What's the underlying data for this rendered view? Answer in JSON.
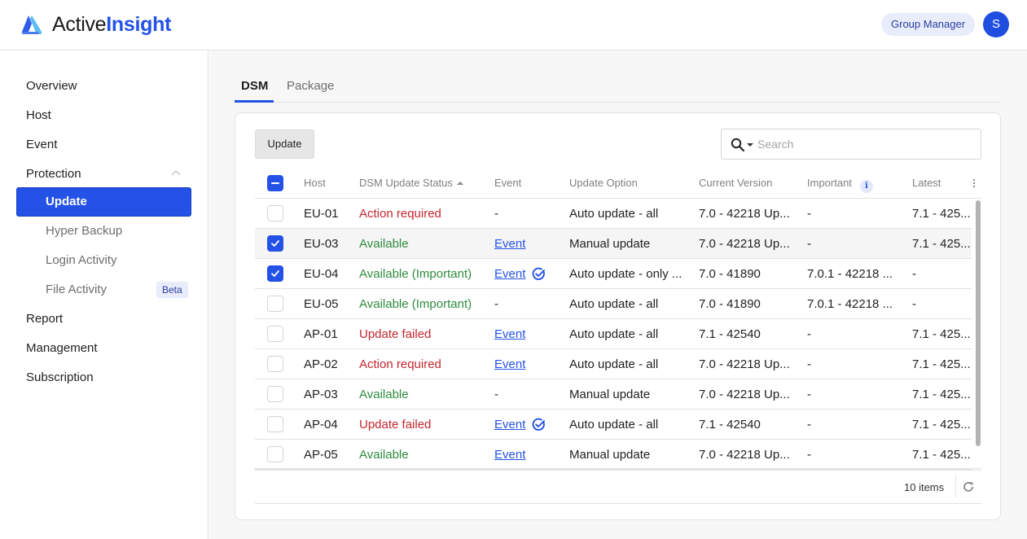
{
  "header": {
    "brand_part1": "Active",
    "brand_part2": "Insight",
    "role": "Group Manager",
    "avatar_initial": "S"
  },
  "sidebar": {
    "items": [
      {
        "label": "Overview"
      },
      {
        "label": "Host"
      },
      {
        "label": "Event"
      },
      {
        "label": "Protection",
        "expanded": true
      },
      {
        "label": "Report"
      },
      {
        "label": "Management"
      },
      {
        "label": "Subscription"
      }
    ],
    "protection_children": [
      {
        "label": "Update",
        "active": true
      },
      {
        "label": "Hyper Backup"
      },
      {
        "label": "Login Activity"
      },
      {
        "label": "File Activity",
        "badge": "Beta"
      }
    ]
  },
  "tabs": [
    {
      "label": "DSM",
      "active": true
    },
    {
      "label": "Package"
    }
  ],
  "toolbar": {
    "update_label": "Update",
    "search_placeholder": "Search",
    "search_value": ""
  },
  "table": {
    "columns": [
      "Host",
      "DSM Update Status",
      "Event",
      "Update Option",
      "Current Version",
      "Important",
      "Latest"
    ],
    "sort_column": "DSM Update Status",
    "sort_direction": "ascending",
    "select_all_state": "indeterminate",
    "rows": [
      {
        "selected": false,
        "host": "EU-01",
        "status": "Action required",
        "status_type": "error",
        "event": "-",
        "event_link": false,
        "event_checked": false,
        "update_option": "Auto update - all",
        "current_version": "7.0 - 42218 Up...",
        "important": "-",
        "latest": "7.1 - 425..."
      },
      {
        "selected": true,
        "host": "EU-03",
        "status": "Available",
        "status_type": "ok",
        "event": "Event",
        "event_link": true,
        "event_checked": false,
        "update_option": "Manual update",
        "current_version": "7.0 - 42218 Up...",
        "important": "-",
        "latest": "7.1 - 425..."
      },
      {
        "selected": true,
        "host": "EU-04",
        "status": "Available (Important)",
        "status_type": "ok",
        "event": "Event",
        "event_link": true,
        "event_checked": true,
        "update_option": "Auto update - only ...",
        "current_version": "7.0 - 41890",
        "important": "7.0.1 - 42218 ...",
        "latest": "-"
      },
      {
        "selected": false,
        "host": "EU-05",
        "status": "Available (Important)",
        "status_type": "ok",
        "event": "-",
        "event_link": false,
        "event_checked": false,
        "update_option": "Auto update - all",
        "current_version": "7.0 - 41890",
        "important": "7.0.1 - 42218 ...",
        "latest": "-"
      },
      {
        "selected": false,
        "host": "AP-01",
        "status": "Update failed",
        "status_type": "error",
        "event": "Event",
        "event_link": true,
        "event_checked": false,
        "update_option": "Auto update - all",
        "current_version": "7.1 - 42540",
        "important": "-",
        "latest": "7.1 - 425..."
      },
      {
        "selected": false,
        "host": "AP-02",
        "status": "Action required",
        "status_type": "error",
        "event": "Event",
        "event_link": true,
        "event_checked": false,
        "update_option": "Auto update - all",
        "current_version": "7.0 - 42218 Up...",
        "important": "-",
        "latest": "7.1 - 425..."
      },
      {
        "selected": false,
        "host": "AP-03",
        "status": "Available",
        "status_type": "ok",
        "event": "-",
        "event_link": false,
        "event_checked": false,
        "update_option": "Manual update",
        "current_version": "7.0 - 42218 Up...",
        "important": "-",
        "latest": "7.1 - 425..."
      },
      {
        "selected": false,
        "host": "AP-04",
        "status": "Update failed",
        "status_type": "error",
        "event": "Event",
        "event_link": true,
        "event_checked": true,
        "update_option": "Auto update - all",
        "current_version": "7.1 - 42540",
        "important": "-",
        "latest": "7.1 - 425..."
      },
      {
        "selected": false,
        "host": "AP-05",
        "status": "Available",
        "status_type": "ok",
        "event": "Event",
        "event_link": true,
        "event_checked": false,
        "update_option": "Manual update",
        "current_version": "7.0 - 42218 Up...",
        "important": "-",
        "latest": "7.1 - 425..."
      }
    ],
    "item_count": "10 items"
  },
  "colors": {
    "accent": "#2452e6",
    "error": "#c4262e",
    "success": "#2e8b3e"
  }
}
